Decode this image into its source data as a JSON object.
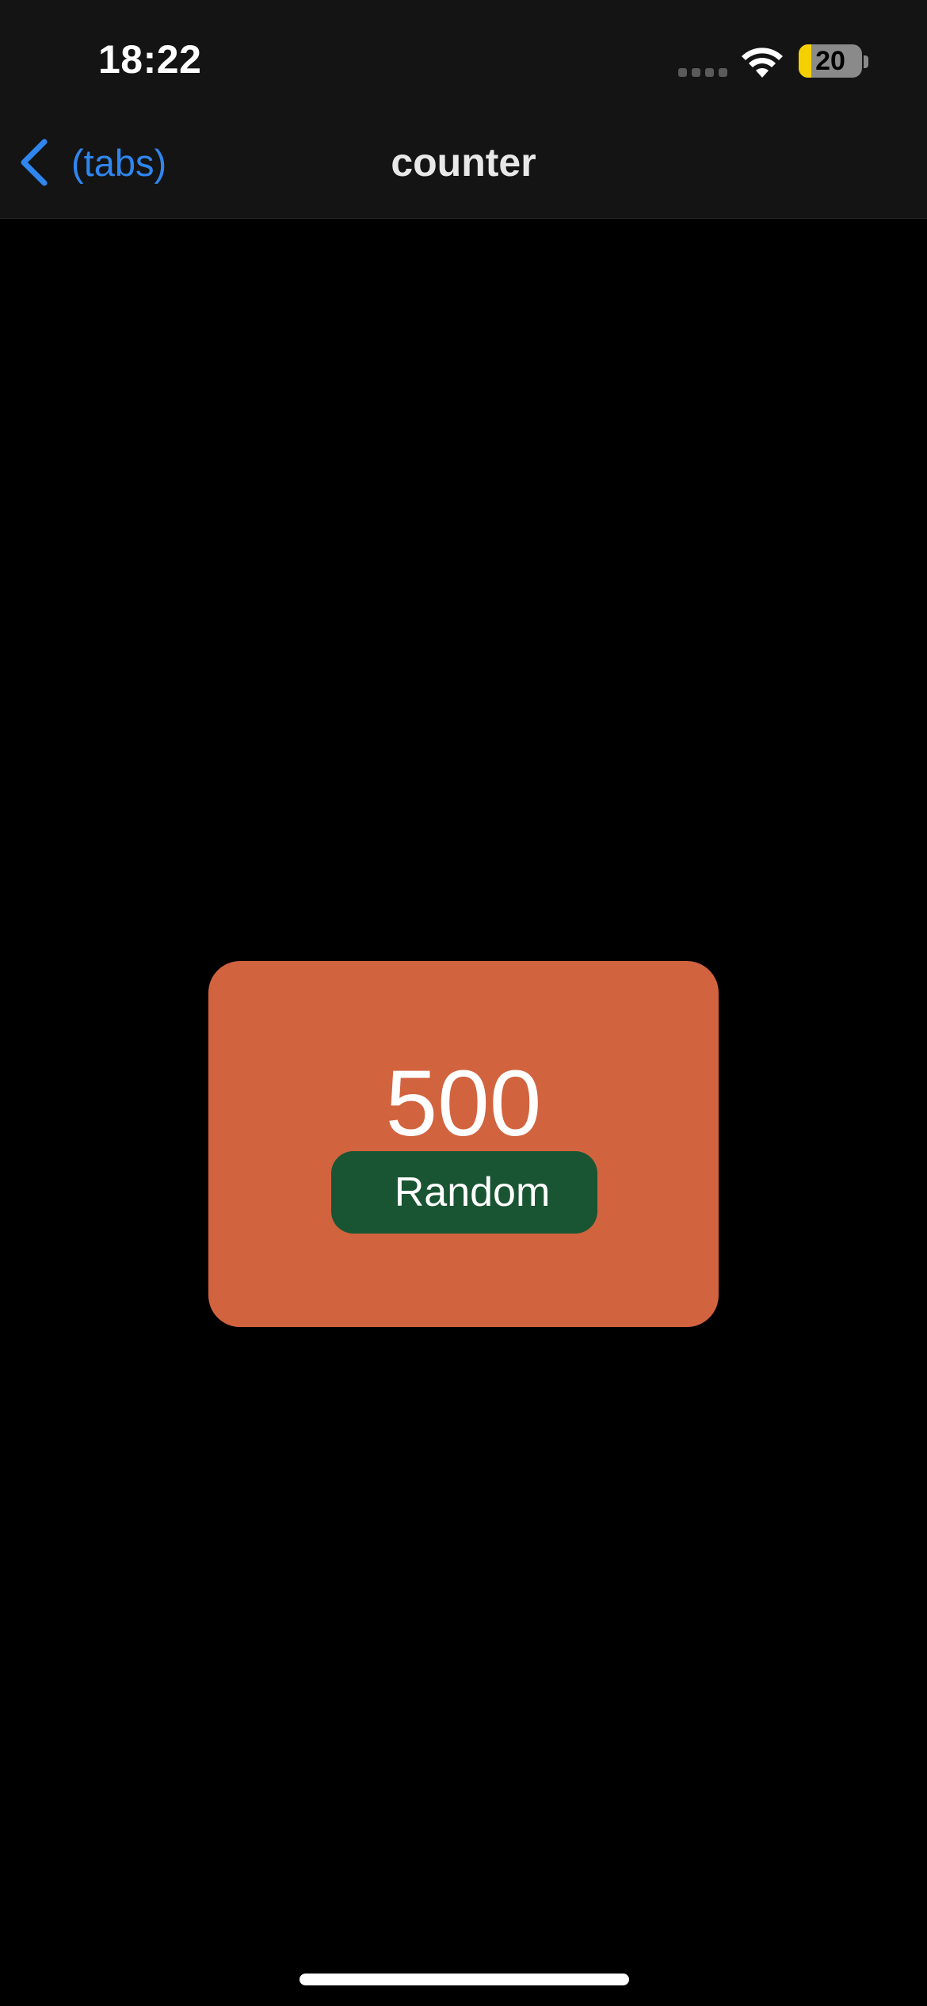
{
  "status_bar": {
    "time": "18:22",
    "battery_level": "20",
    "battery_fraction": 0.2,
    "icons": [
      "cellular-signal-icon",
      "wifi-icon",
      "battery-icon"
    ]
  },
  "nav": {
    "back_label": "(tabs)",
    "title": "counter",
    "back_icon": "chevron-left-icon"
  },
  "counter": {
    "value": "500",
    "button_label": "Random"
  },
  "colors": {
    "background": "#000000",
    "nav_background": "#141414",
    "accent_blue": "#2f86ee",
    "card": "#d2633f",
    "button": "#1a5533",
    "battery_fill": "#f5d000"
  }
}
